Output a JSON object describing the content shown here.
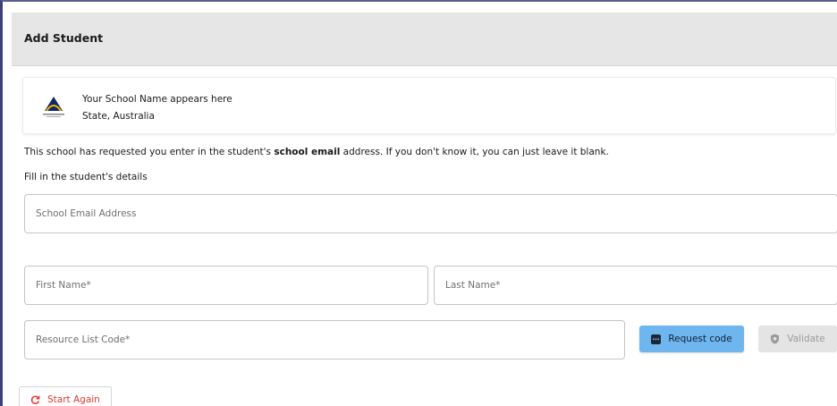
{
  "header": {
    "title": "Add Student"
  },
  "school": {
    "name": "Your School Name appears here",
    "state": "State, Australia"
  },
  "notice": {
    "before": "This school has requested you enter in the student's ",
    "bold": "school email",
    "after": " address. If you don't know it, you can just leave it blank."
  },
  "form": {
    "section_label": "Fill in the student's details",
    "email_placeholder": "School Email Address",
    "first_name_placeholder": "First Name*",
    "last_name_placeholder": "Last Name*",
    "resource_code_placeholder": "Resource List Code*"
  },
  "buttons": {
    "request_code": "Request code",
    "validate": "Validate",
    "start_again": "Start Again"
  },
  "colors": {
    "accent": "#6fb6ef",
    "danger": "#e53935",
    "disabled": "#e4e4e4"
  },
  "icons": {
    "request": "keypad-icon",
    "validate": "shield-check-icon",
    "restart": "refresh-icon"
  }
}
